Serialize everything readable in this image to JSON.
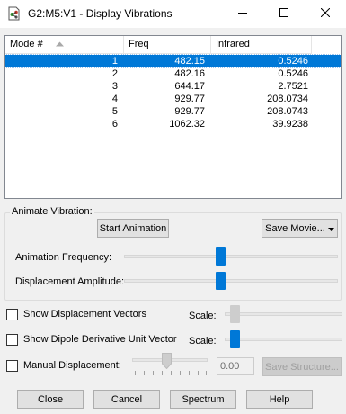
{
  "window": {
    "title": "G2:M5:V1 - Display Vibrations",
    "icon": "molecule-document-icon",
    "controls": [
      "minimize",
      "maximize",
      "close"
    ]
  },
  "table": {
    "columns": [
      "Mode #",
      "Freq",
      "Infrared"
    ],
    "sort_indicator": "sort-ascending-icon",
    "rows": [
      {
        "mode": "1",
        "freq": "482.15",
        "ir": "0.5246"
      },
      {
        "mode": "2",
        "freq": "482.16",
        "ir": "0.5246"
      },
      {
        "mode": "3",
        "freq": "644.17",
        "ir": "2.7521"
      },
      {
        "mode": "4",
        "freq": "929.77",
        "ir": "208.0734"
      },
      {
        "mode": "5",
        "freq": "929.77",
        "ir": "208.0743"
      },
      {
        "mode": "6",
        "freq": "1062.32",
        "ir": "39.9238"
      }
    ],
    "selected_row": 0
  },
  "animate": {
    "legend": "Animate Vibration:",
    "start_label": "Start Animation",
    "save_movie_label": "Save Movie...",
    "frequency_label": "Animation Frequency:",
    "frequency_level": 0.45,
    "amplitude_label": "Displacement Amplitude:",
    "amplitude_level": 0.45
  },
  "options": {
    "show_vectors_label": "Show Displacement Vectors",
    "show_dipole_label": "Show Dipole Derivative Unit Vector",
    "scale_label": "Scale:",
    "vectors_scale_level": 0.05,
    "dipole_scale_level": 0.05,
    "manual_label": "Manual Displacement:",
    "manual_level": 0.45,
    "manual_value": "0.00",
    "save_structure_label": "Save Structure..."
  },
  "footer": {
    "close_label": "Close",
    "cancel_label": "Cancel",
    "spectrum_label": "Spectrum",
    "help_label": "Help"
  },
  "colors": {
    "selection": "#0078d7",
    "slider_thumb": "#0078d7"
  }
}
